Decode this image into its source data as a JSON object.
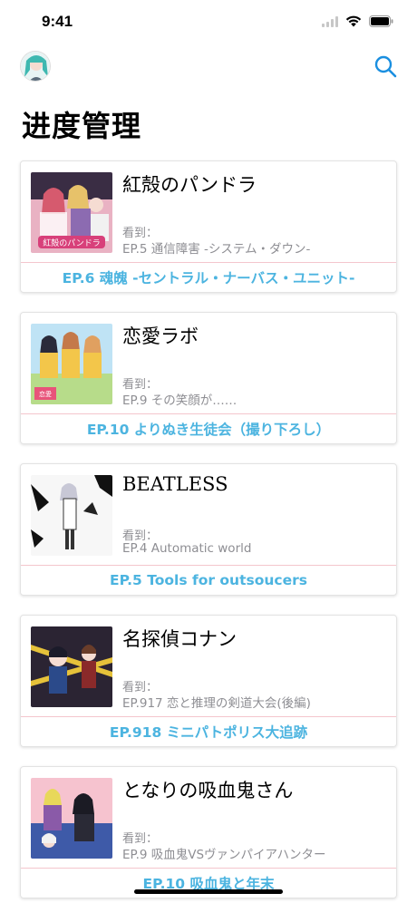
{
  "status_bar": {
    "time": "9:41"
  },
  "header": {
    "title": "进度管理",
    "search_icon": "search-icon",
    "avatar_icon": "avatar"
  },
  "colors": {
    "accent": "#4cb4e0",
    "divider": "#f4c6cd",
    "secondary_text": "#8e8e93"
  },
  "items": [
    {
      "title": "紅殻のパンドラ",
      "watched_label": "看到：",
      "watched_ep": "EP.5 通信障害 -システム・ダウン-",
      "next_ep": "EP.6 魂魄 -セントラル・ナーバス・ユニット-"
    },
    {
      "title": "恋愛ラボ",
      "watched_label": "看到：",
      "watched_ep": "EP.9 その笑顔が……",
      "next_ep": "EP.10 よりぬき生徒会（撮り下ろし）"
    },
    {
      "title": "BEATLESS",
      "watched_label": "看到：",
      "watched_ep": "EP.4 Automatic world",
      "next_ep": "EP.5 Tools for outsoucers"
    },
    {
      "title": "名探偵コナン",
      "watched_label": "看到：",
      "watched_ep": "EP.917 恋と推理の剣道大会(後編)",
      "next_ep": "EP.918 ミニパトポリス大追跡"
    },
    {
      "title": "となりの吸血鬼さん",
      "watched_label": "看到：",
      "watched_ep": "EP.9 吸血鬼VSヴァンパイアハンター",
      "next_ep": "EP.10 吸血鬼と年末"
    }
  ]
}
